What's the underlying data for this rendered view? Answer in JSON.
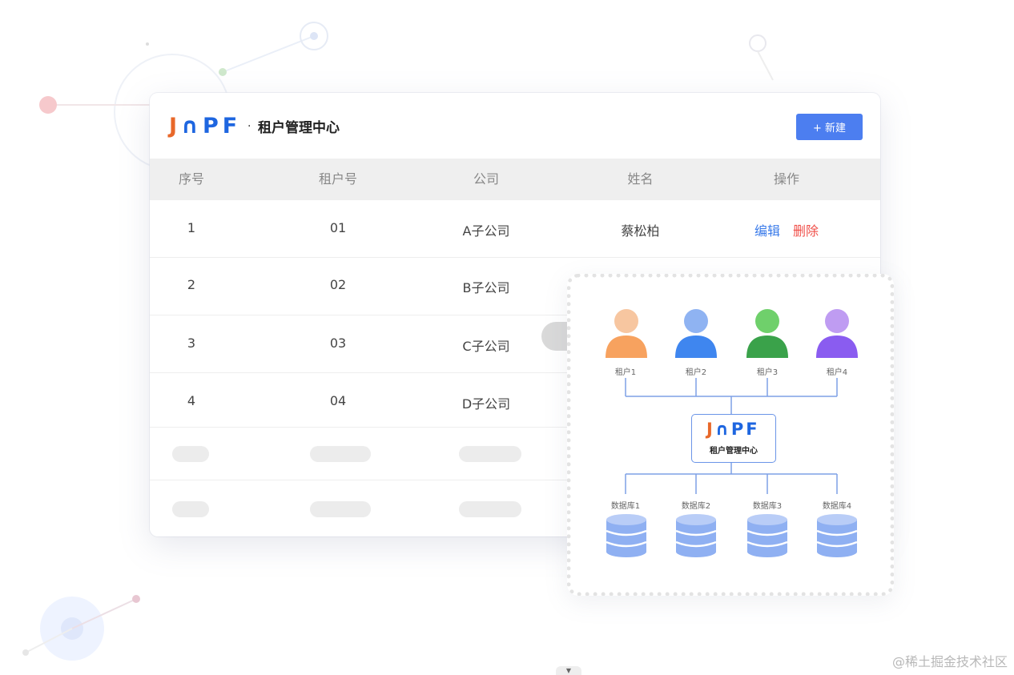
{
  "header": {
    "logo_j": "J",
    "logo_n": "∩",
    "logo_p": "P",
    "logo_f": "F",
    "separator": "·",
    "title": "租户管理中心",
    "new_button": "+ 新建"
  },
  "table": {
    "columns": [
      "序号",
      "租户号",
      "公司",
      "姓名",
      "操作"
    ],
    "rows": [
      {
        "index": "1",
        "tenant": "01",
        "company": "A子公司",
        "name": "蔡松柏",
        "edit": "编辑",
        "delete": "删除"
      },
      {
        "index": "2",
        "tenant": "02",
        "company": "B子公司"
      },
      {
        "index": "3",
        "tenant": "03",
        "company": "C子公司"
      },
      {
        "index": "4",
        "tenant": "04",
        "company": "D子公司"
      }
    ]
  },
  "diagram": {
    "tenants": [
      {
        "label": "租户1",
        "color": "#f7a25f"
      },
      {
        "label": "租户2",
        "color": "#3f86ef"
      },
      {
        "label": "租户3",
        "color": "#3aa24a"
      },
      {
        "label": "租户4",
        "color": "#8a5cf0"
      }
    ],
    "center_title": "租户管理中心",
    "databases": [
      {
        "label": "数据库1"
      },
      {
        "label": "数据库2"
      },
      {
        "label": "数据库3"
      },
      {
        "label": "数据库4"
      }
    ]
  },
  "colors": {
    "accent": "#4c7ef0",
    "logo_orange": "#e8682a",
    "logo_blue": "#1e66e0",
    "edit": "#3a7bea",
    "delete": "#f0504a",
    "database": "#8fb0f2"
  },
  "watermark": "@稀土掘金技术社区"
}
